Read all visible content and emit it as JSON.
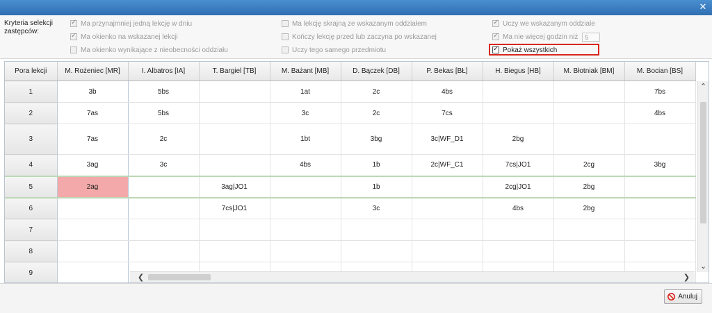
{
  "window": {
    "close_icon": "✕"
  },
  "criteria": {
    "label": "Kryteria selekcji zastępców:",
    "options": [
      {
        "label": "Ma przynajmniej jedną lekcję w dniu",
        "checked": true,
        "enabled": false
      },
      {
        "label": "Ma okienko na wskazanej lekcji",
        "checked": true,
        "enabled": false
      },
      {
        "label": "Ma okienko wynikające z nieobecności oddziału",
        "checked": false,
        "enabled": false
      },
      {
        "label": "Ma lekcję skrajną ze wskazanym oddziałem",
        "checked": false,
        "enabled": false
      },
      {
        "label": "Kończy lekcję przed lub zaczyna po wskazanej",
        "checked": false,
        "enabled": false
      },
      {
        "label": "Uczy tego samego przedmiotu",
        "checked": false,
        "enabled": false
      },
      {
        "label": "Uczy we wskazanym oddziale",
        "checked": true,
        "enabled": false
      },
      {
        "label": "Ma nie więcej godzin niż",
        "checked": true,
        "enabled": false,
        "value": "5"
      },
      {
        "label": "Pokaż wszystkich",
        "checked": true,
        "enabled": true
      }
    ]
  },
  "grid": {
    "columns": [
      "Pora lekcji",
      "M. Rożeniec [MR]",
      "I. Albatros [IA]",
      "T. Bargiel [TB]",
      "M. Bażant [MB]",
      "D. Bączek [DB]",
      "P. Bekas [BŁ]",
      "H. Biegus [HB]",
      "M. Błotniak [BM]",
      "M. Bocian [BS]"
    ],
    "rows": [
      {
        "period": "1",
        "cells": [
          "3b",
          "5bs",
          "",
          "1at",
          "2c",
          "4bs",
          "",
          "",
          "7bs"
        ]
      },
      {
        "period": "2",
        "cells": [
          "7as",
          "5bs",
          "",
          "3c",
          "2c",
          "7cs",
          "",
          "",
          "4bs"
        ]
      },
      {
        "period": "3",
        "cells": [
          "7as",
          "2c",
          "",
          "1bt",
          "3bg",
          "3c|WF_D1",
          "2bg",
          "",
          ""
        ]
      },
      {
        "period": "4",
        "cells": [
          "3ag",
          "3c",
          "",
          "4bs",
          "1b",
          "2c|WF_C1",
          "7cs|JO1",
          "2cg",
          "3bg"
        ]
      },
      {
        "period": "5",
        "cells": [
          "2ag",
          "",
          "3ag|JO1",
          "",
          "1b",
          "",
          "2cg|JO1",
          "2bg",
          ""
        ]
      },
      {
        "period": "6",
        "cells": [
          "",
          "",
          "7cs|JO1",
          "",
          "3c",
          "",
          "4bs",
          "2bg",
          ""
        ]
      },
      {
        "period": "7",
        "cells": [
          "",
          "",
          "",
          "",
          "",
          "",
          "",
          "",
          ""
        ]
      },
      {
        "period": "8",
        "cells": [
          "",
          "",
          "",
          "",
          "",
          "",
          "",
          "",
          ""
        ]
      },
      {
        "period": "9",
        "cells": [
          "",
          "",
          "",
          "",
          "",
          "",
          "",
          "",
          ""
        ]
      }
    ],
    "highlighted_cell": {
      "period": "5",
      "teacher": "M. Rożeniec [MR]",
      "color": "#f3a9a9"
    }
  },
  "scroll_icons": {
    "up": "⌃",
    "down": "⌄",
    "left": "❮",
    "right": "❯"
  },
  "footer": {
    "cancel_label": "Anuluj",
    "cancel_icon": "no-entry-icon"
  },
  "colors": {
    "titlebar": "#3a7fc4",
    "highlight_border": "#d9261c",
    "cell_highlight": "#f3a9a9"
  }
}
